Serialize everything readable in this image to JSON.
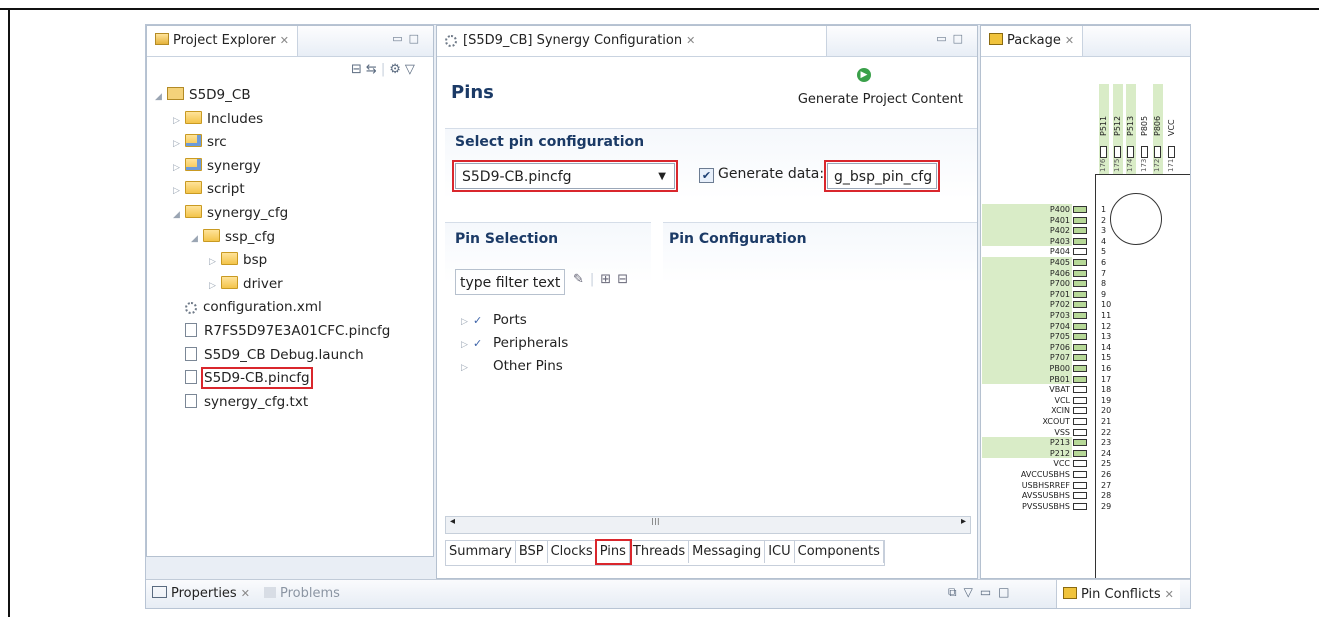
{
  "project_explorer": {
    "title": "Project Explorer",
    "tree": [
      {
        "label": "S5D9_CB",
        "type": "project",
        "indent": 0,
        "twisty": "expanded"
      },
      {
        "label": "Includes",
        "type": "includes",
        "indent": 1,
        "twisty": "collapsed"
      },
      {
        "label": "src",
        "type": "src-folder",
        "indent": 1,
        "twisty": "collapsed"
      },
      {
        "label": "synergy",
        "type": "src-folder",
        "indent": 1,
        "twisty": "collapsed"
      },
      {
        "label": "script",
        "type": "folder",
        "indent": 1,
        "twisty": "collapsed"
      },
      {
        "label": "synergy_cfg",
        "type": "folder",
        "indent": 1,
        "twisty": "expanded"
      },
      {
        "label": "ssp_cfg",
        "type": "folder",
        "indent": 2,
        "twisty": "expanded"
      },
      {
        "label": "bsp",
        "type": "folder",
        "indent": 3,
        "twisty": "collapsed"
      },
      {
        "label": "driver",
        "type": "folder",
        "indent": 3,
        "twisty": "collapsed"
      },
      {
        "label": "configuration.xml",
        "type": "gear",
        "indent": 1,
        "twisty": ""
      },
      {
        "label": "R7FS5D97E3A01CFC.pincfg",
        "type": "file",
        "indent": 1,
        "twisty": ""
      },
      {
        "label": "S5D9_CB Debug.launch",
        "type": "file",
        "indent": 1,
        "twisty": ""
      },
      {
        "label": "S5D9-CB.pincfg",
        "type": "file",
        "indent": 1,
        "twisty": "",
        "highlighted": true
      },
      {
        "label": "synergy_cfg.txt",
        "type": "file",
        "indent": 1,
        "twisty": ""
      }
    ]
  },
  "editor": {
    "tab_title": "[S5D9_CB] Synergy Configuration",
    "page_title": "Pins",
    "generate_label": "Generate Project Content",
    "select_section": "Select pin configuration",
    "pin_config_value": "S5D9-CB.pincfg",
    "generate_data_label": "Generate data:",
    "generate_data_checked": true,
    "generate_data_value": "g_bsp_pin_cfg",
    "pin_selection_title": "Pin Selection",
    "pin_configuration_title": "Pin Configuration",
    "filter_placeholder": "type filter text",
    "pin_tree": [
      {
        "label": "Ports",
        "checked": true
      },
      {
        "label": "Peripherals",
        "checked": true
      },
      {
        "label": "Other Pins",
        "checked": false
      }
    ],
    "bottom_tabs": [
      "Summary",
      "BSP",
      "Clocks",
      "Pins",
      "Threads",
      "Messaging",
      "ICU",
      "Components"
    ],
    "active_tab": "Pins",
    "scroll_marker": "III"
  },
  "package": {
    "title": "Package",
    "top_pins": [
      {
        "name": "P511",
        "num": "176",
        "green": true
      },
      {
        "name": "P512",
        "num": "175",
        "green": true
      },
      {
        "name": "P513",
        "num": "174",
        "green": true
      },
      {
        "name": "P805",
        "num": "173",
        "green": false
      },
      {
        "name": "P806",
        "num": "172",
        "green": true
      },
      {
        "name": "VCC",
        "num": "171",
        "green": false
      }
    ],
    "pins": [
      {
        "name": "P400",
        "num": "1",
        "green": true
      },
      {
        "name": "P401",
        "num": "2",
        "green": true
      },
      {
        "name": "P402",
        "num": "3",
        "green": true
      },
      {
        "name": "P403",
        "num": "4",
        "green": true
      },
      {
        "name": "P404",
        "num": "5",
        "green": false
      },
      {
        "name": "P405",
        "num": "6",
        "green": true
      },
      {
        "name": "P406",
        "num": "7",
        "green": true
      },
      {
        "name": "P700",
        "num": "8",
        "green": true
      },
      {
        "name": "P701",
        "num": "9",
        "green": true
      },
      {
        "name": "P702",
        "num": "10",
        "green": true
      },
      {
        "name": "P703",
        "num": "11",
        "green": true
      },
      {
        "name": "P704",
        "num": "12",
        "green": true
      },
      {
        "name": "P705",
        "num": "13",
        "green": true
      },
      {
        "name": "P706",
        "num": "14",
        "green": true
      },
      {
        "name": "P707",
        "num": "15",
        "green": true
      },
      {
        "name": "PB00",
        "num": "16",
        "green": true
      },
      {
        "name": "PB01",
        "num": "17",
        "green": true
      },
      {
        "name": "VBAT",
        "num": "18",
        "green": false
      },
      {
        "name": "VCL",
        "num": "19",
        "green": false
      },
      {
        "name": "XCIN",
        "num": "20",
        "green": false
      },
      {
        "name": "XCOUT",
        "num": "21",
        "green": false
      },
      {
        "name": "VSS",
        "num": "22",
        "green": false
      },
      {
        "name": "P213",
        "num": "23",
        "green": true
      },
      {
        "name": "P212",
        "num": "24",
        "green": true
      },
      {
        "name": "VCC",
        "num": "25",
        "green": false
      },
      {
        "name": "AVCCUSBHS",
        "num": "26",
        "green": false
      },
      {
        "name": "USBHSRREF",
        "num": "27",
        "green": false
      },
      {
        "name": "AVSSUSBHS",
        "num": "28",
        "green": false
      },
      {
        "name": "PVSSUSBHS",
        "num": "29",
        "green": false
      }
    ]
  },
  "bottom_bar": {
    "properties_label": "Properties",
    "problems_label": "Problems",
    "pin_conflicts_label": "Pin Conflicts"
  },
  "colors": {
    "highlight": "#d9262c",
    "pin_green": "#d9ecc7",
    "title_blue": "#1b3a66"
  }
}
